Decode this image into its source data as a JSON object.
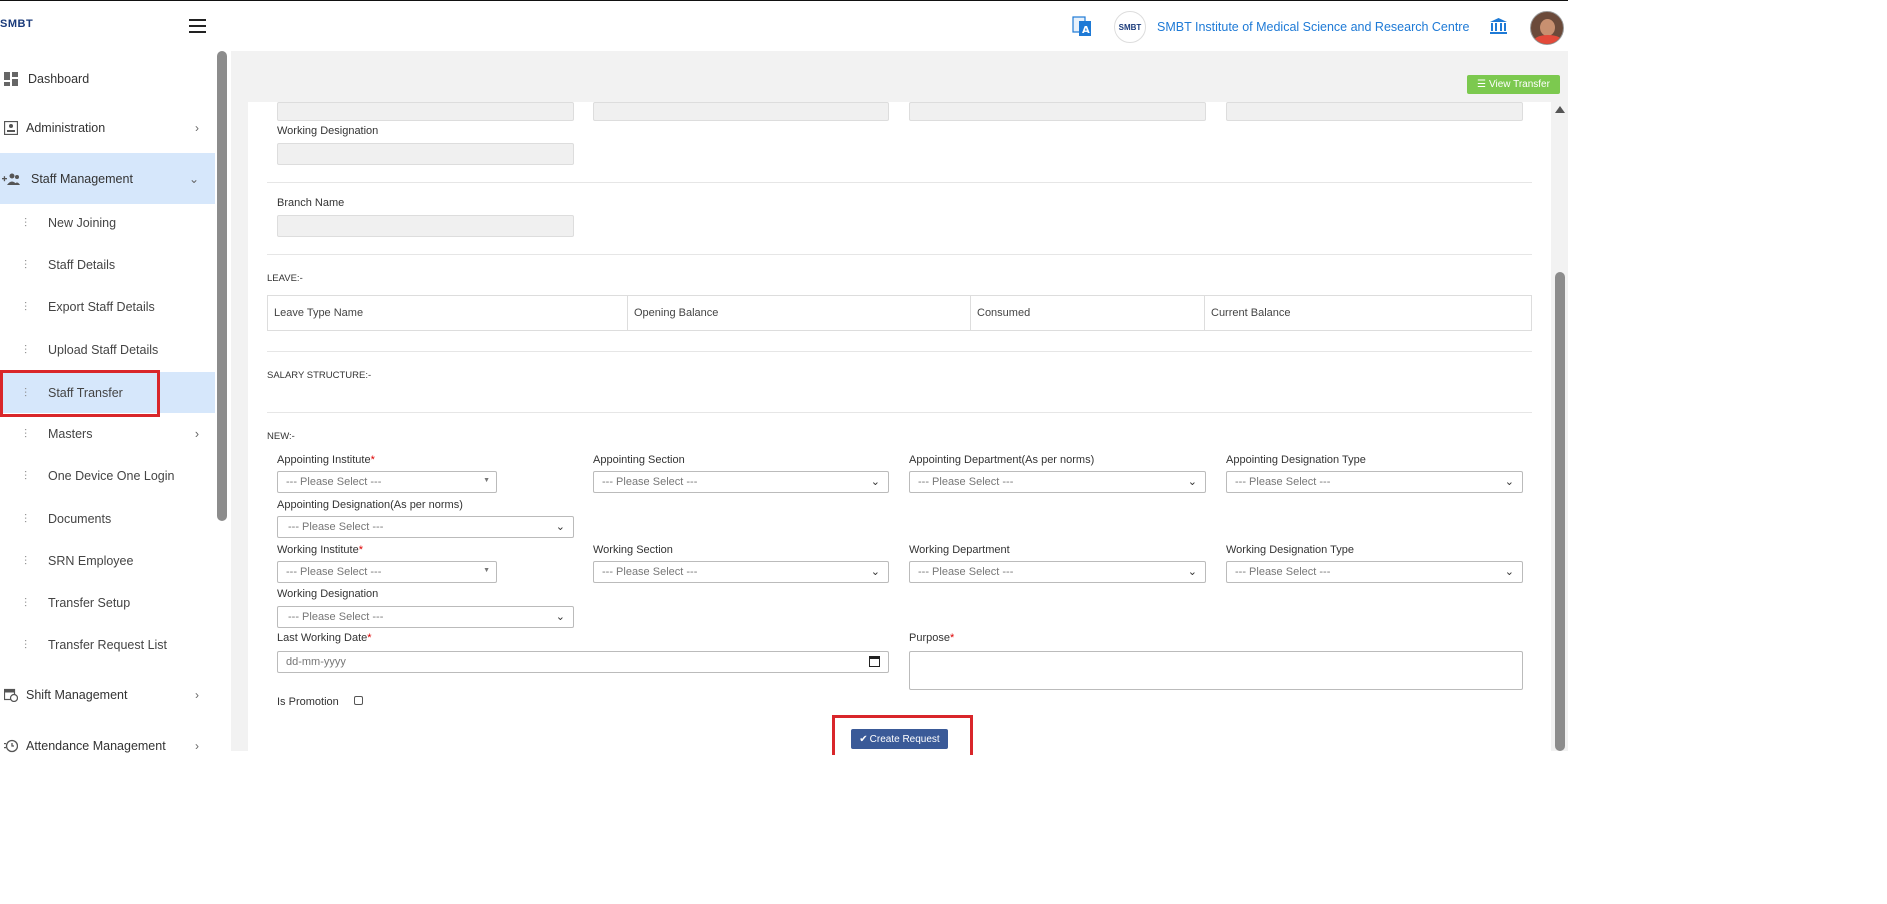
{
  "header": {
    "brand": "SMBT",
    "logo_text": "SMBT",
    "institute_name": "SMBT Institute of Medical Science and Research Centre"
  },
  "sidebar": {
    "items": [
      {
        "label": "Dashboard",
        "icon": "dashboard-icon"
      },
      {
        "label": "Administration",
        "icon": "id-card-icon"
      },
      {
        "label": "Staff Management",
        "icon": "users-icon"
      },
      {
        "label": "Shift Management",
        "icon": "calendar-clock-icon"
      },
      {
        "label": "Attendance Management",
        "icon": "clock-icon"
      }
    ],
    "sub_items": [
      "New Joining",
      "Staff Details",
      "Export Staff Details",
      "Upload Staff Details",
      "Staff Transfer",
      "Masters",
      "One Device One Login",
      "Documents",
      "SRN Employee",
      "Transfer Setup",
      "Transfer Request List"
    ]
  },
  "toolbar": {
    "view_transfer": "View Transfer"
  },
  "form": {
    "working_designation_label": "Working Designation",
    "branch_name_label": "Branch Name",
    "leave_title": "LEAVE:-",
    "leave_columns": [
      "Leave Type Name",
      "Opening Balance",
      "Consumed",
      "Current Balance"
    ],
    "salary_title": "SALARY STRUCTURE:-",
    "new_title": "NEW:-",
    "appointing_institute": "Appointing Institute",
    "appointing_section": "Appointing Section",
    "appointing_department": "Appointing Department(As per norms)",
    "appointing_designation_type": "Appointing Designation Type",
    "appointing_designation": "Appointing Designation(As per norms)",
    "working_institute": "Working Institute",
    "working_section": "Working Section",
    "working_department": "Working Department",
    "working_designation_type": "Working Designation Type",
    "working_designation": "Working Designation",
    "last_working_date": "Last Working Date",
    "purpose": "Purpose",
    "is_promotion": "Is Promotion",
    "placeholder_select": "--- Please Select ---",
    "date_placeholder": "dd-mm-yyyy",
    "required_mark": "*",
    "create_request": "Create Request"
  },
  "colors": {
    "accent_blue": "#1e7ad6",
    "active_bg": "#d6e7fb",
    "green_button": "#7cc94f",
    "create_button": "#3a5a98",
    "highlight_red": "#d9262a"
  }
}
